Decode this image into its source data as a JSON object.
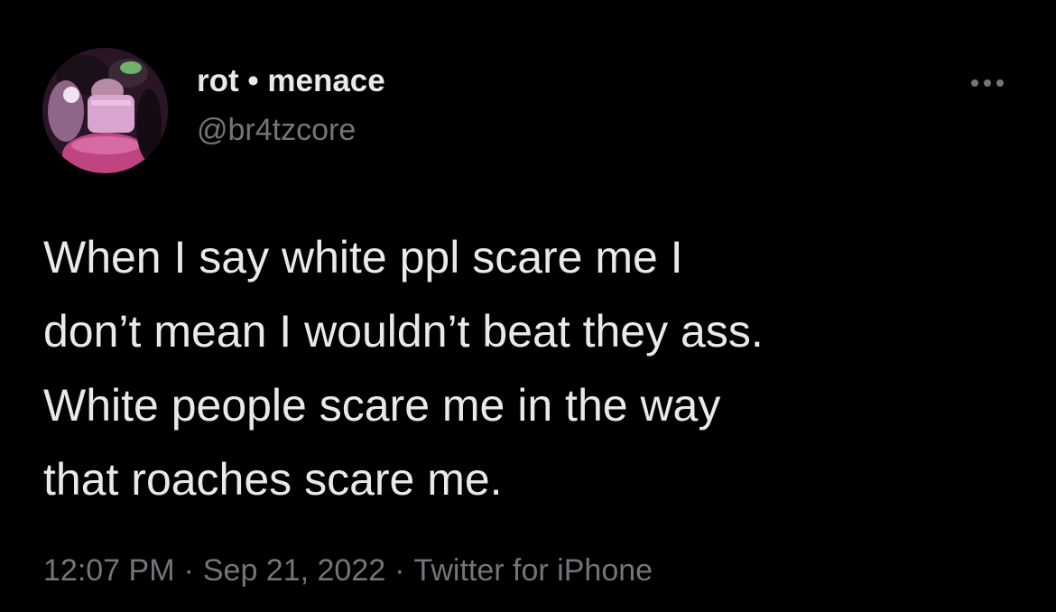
{
  "tweet": {
    "author": {
      "display_name": "rot • menace",
      "handle": "@br4tzcore",
      "avatar_icon": "profile-avatar-photo"
    },
    "more_icon": "more-options-icon",
    "text_lines": [
      "When I say white ppl scare me I",
      "don’t mean I wouldn’t beat they ass.",
      "White people scare me in the way",
      "that roaches scare me."
    ],
    "meta": {
      "time": "12:07 PM",
      "separator": "·",
      "date": "Sep 21, 2022",
      "source": "Twitter for iPhone"
    },
    "colors": {
      "background": "#000000",
      "primary_text": "#e7e9ea",
      "secondary_text": "#71767b"
    }
  }
}
